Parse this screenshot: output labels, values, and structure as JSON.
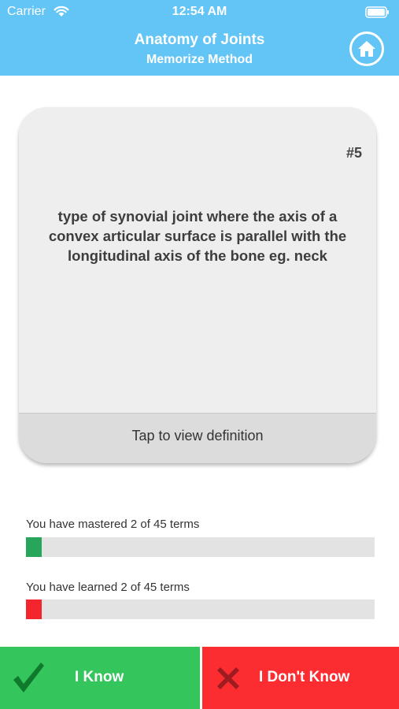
{
  "status_bar": {
    "carrier": "Carrier",
    "time": "12:54 AM"
  },
  "nav": {
    "title": "Anatomy of Joints",
    "subtitle": "Memorize Method",
    "home_icon": "home-icon"
  },
  "card": {
    "number": "#5",
    "term": "type of synovial joint where the axis of a convex articular surface is parallel with the longitudinal axis of the bone eg. neck",
    "footer_label": "Tap to view definition"
  },
  "progress": {
    "mastered_label": "You have mastered 2 of 45 terms",
    "mastered_fraction": 0.0444,
    "mastered_color": "#27a55a",
    "learned_label": "You have learned 2 of 45 terms",
    "learned_fraction": 0.0444,
    "learned_color": "#f2262c"
  },
  "actions": {
    "know_label": "I Know",
    "know_color": "#35c55d",
    "dont_know_label": "I Don't Know",
    "dont_know_color": "#fb2d31"
  },
  "colors": {
    "header": "#63c4f6",
    "card": "#eeeeee"
  }
}
